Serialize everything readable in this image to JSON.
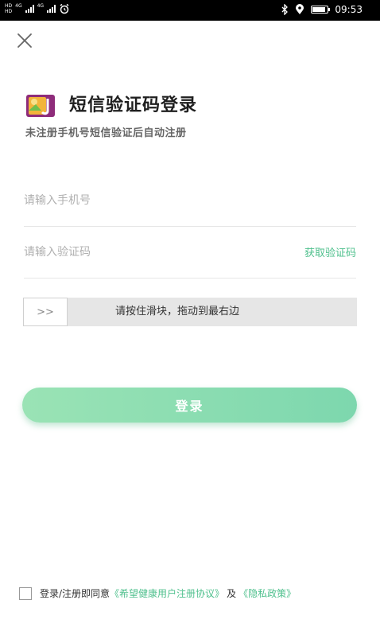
{
  "status_bar": {
    "sim1_tag": "HD",
    "sim2_tag": "HD",
    "net1": "4G",
    "net2": "4G",
    "time": "09:53"
  },
  "header": {
    "title": "短信验证码登录",
    "subtitle": "未注册手机号短信验证后自动注册"
  },
  "phone_field": {
    "placeholder": "请输入手机号",
    "value": ""
  },
  "code_field": {
    "placeholder": "请输入验证码",
    "value": "",
    "get_code_label": "获取验证码"
  },
  "slider": {
    "handle_label": ">>",
    "hint": "请按住滑块，拖动到最右边"
  },
  "login_button": "登录",
  "agreement": {
    "prefix": "登录/注册即同意",
    "user_agreement": "《希望健康用户注册协议》",
    "conjunction": "及",
    "privacy_policy": "《隐私政策》"
  },
  "colors": {
    "accent": "#4fc08d",
    "button_gradient_start": "#9ae3b5",
    "button_gradient_end": "#7dd7ae",
    "slider_track": "#e6e6e6",
    "status_bar": "#000000"
  },
  "icons": {
    "close": "close-icon",
    "logo": "app-logo",
    "bluetooth": "bluetooth-icon",
    "location": "location-icon",
    "battery": "battery-icon",
    "alarm": "alarm-icon"
  },
  "battery_level_percent": 85
}
